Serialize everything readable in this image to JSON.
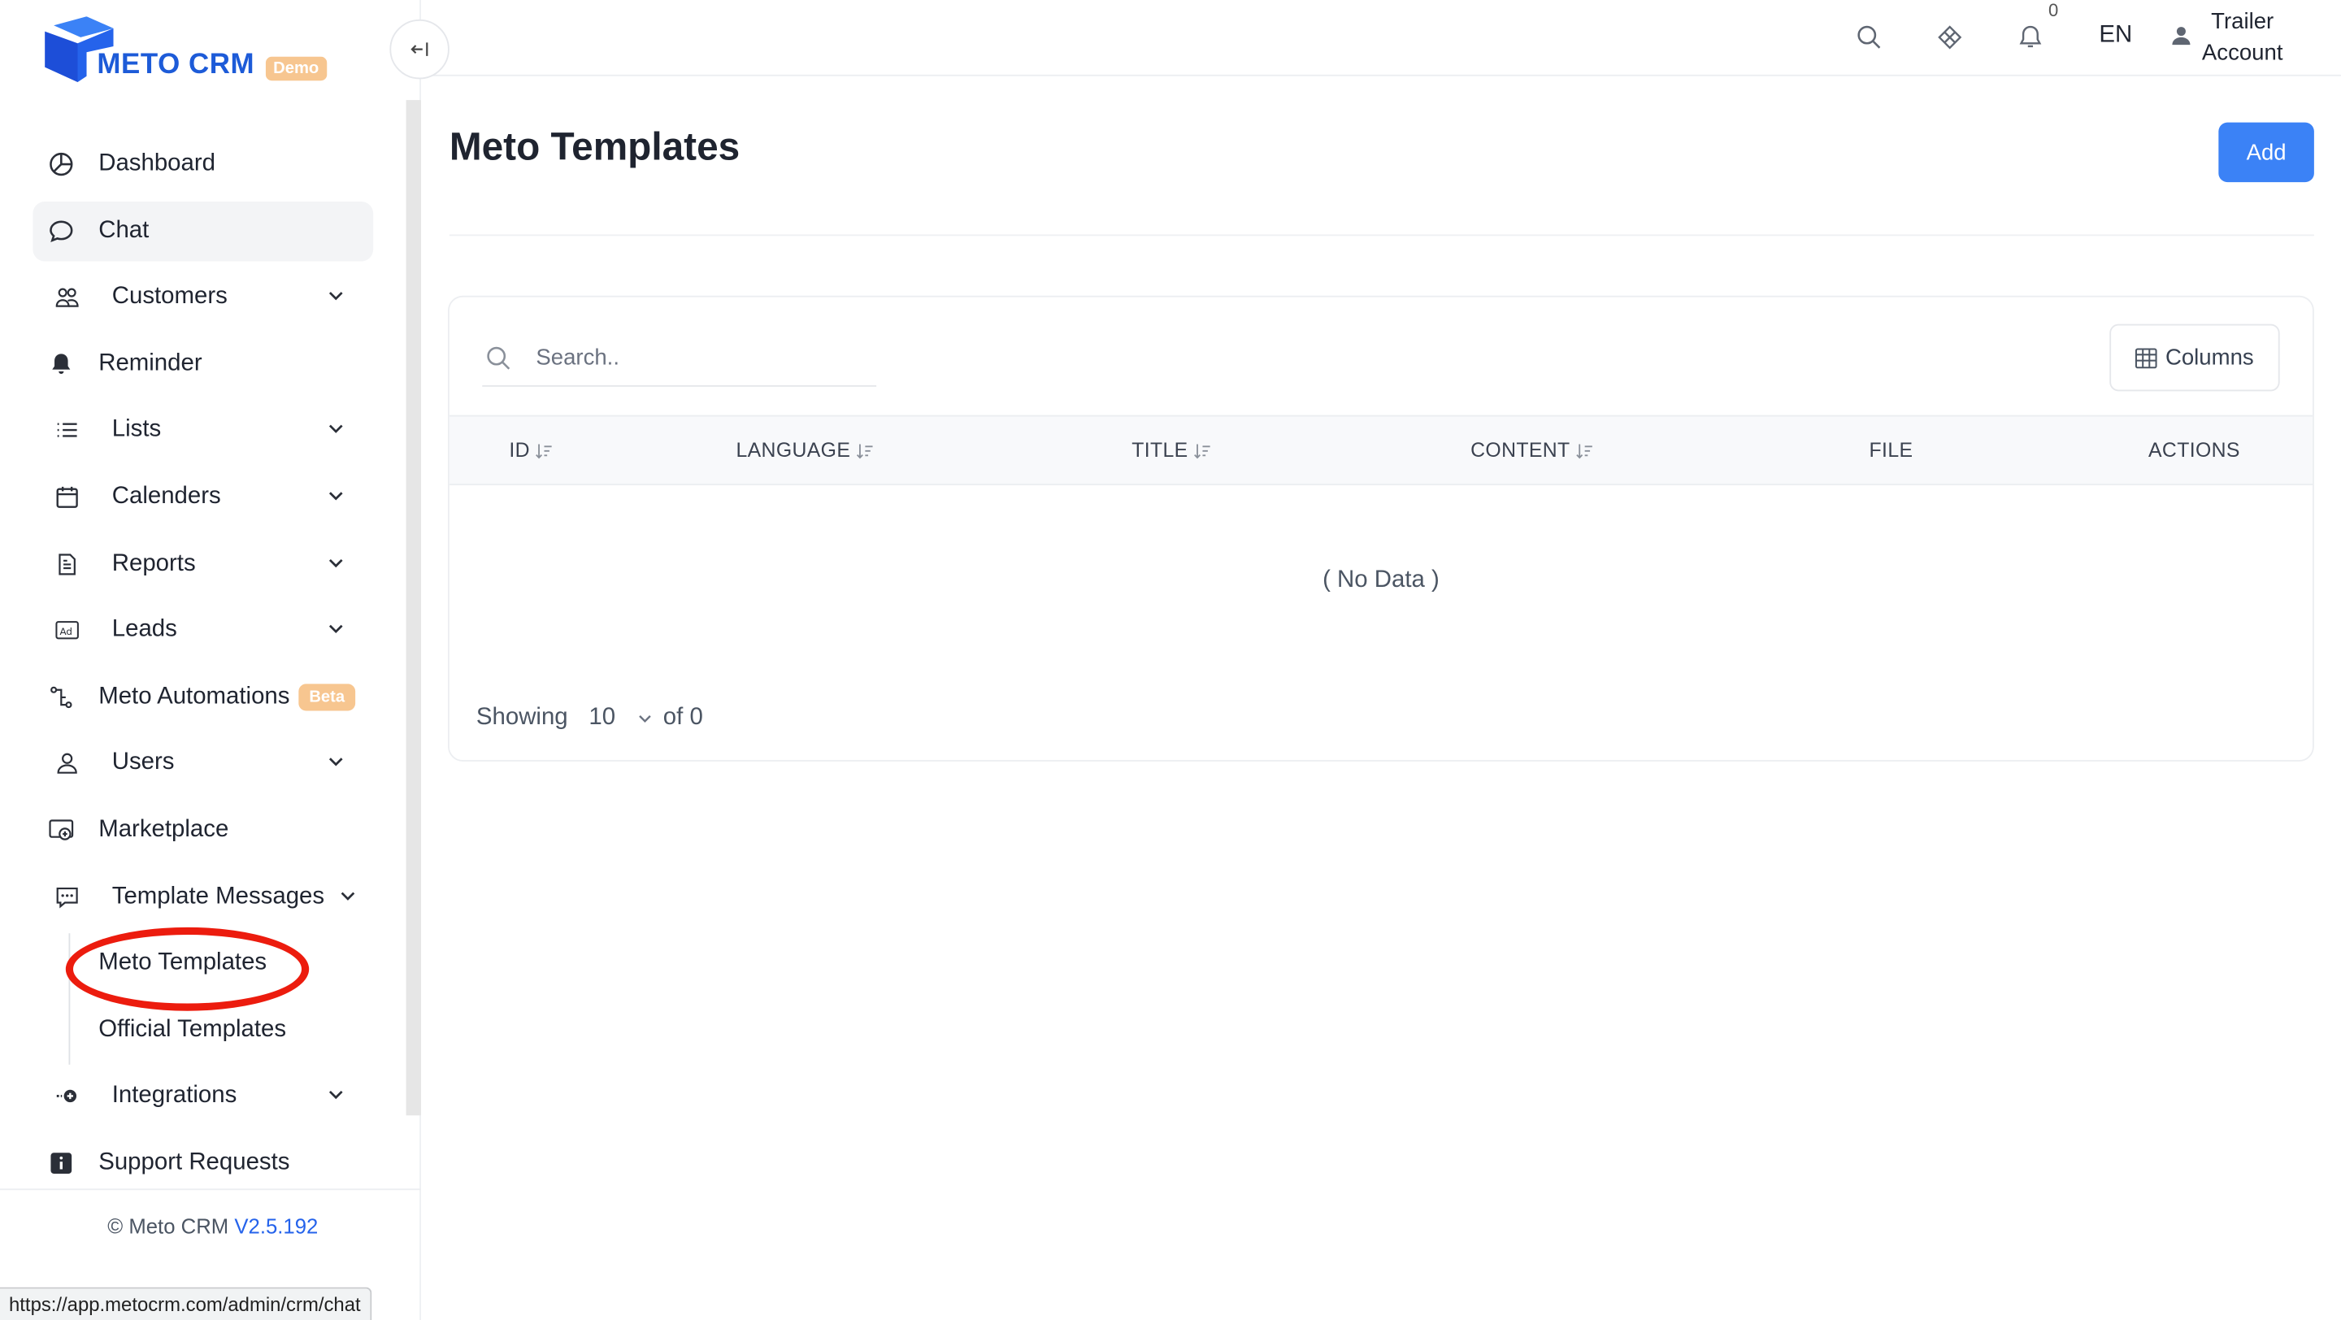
{
  "brand": {
    "name": "METO CRM",
    "badge": "Demo"
  },
  "sidebar": {
    "items": [
      {
        "label": "Dashboard"
      },
      {
        "label": "Chat"
      },
      {
        "label": "Customers"
      },
      {
        "label": "Reminder"
      },
      {
        "label": "Lists"
      },
      {
        "label": "Calenders"
      },
      {
        "label": "Reports"
      },
      {
        "label": "Leads"
      },
      {
        "label": "Meto Automations",
        "badge": "Beta"
      },
      {
        "label": "Users"
      },
      {
        "label": "Marketplace"
      },
      {
        "label": "Template Messages"
      },
      {
        "label": "Integrations"
      },
      {
        "label": "Support Requests"
      }
    ],
    "sub_items": [
      {
        "label": "Meto Templates"
      },
      {
        "label": "Official Templates"
      }
    ],
    "footer": {
      "copyright": "© Meto CRM",
      "version": "V2.5.192"
    }
  },
  "status_url": "https://app.metocrm.com/admin/crm/chat",
  "header": {
    "notification_count": "0",
    "language": "EN",
    "user_first": "Trailer",
    "user_last": "Account"
  },
  "main": {
    "title": "Meto Templates",
    "add_label": "Add",
    "search_placeholder": "Search..",
    "columns_label": "Columns",
    "table": {
      "headers": [
        "ID",
        "LANGUAGE",
        "TITLE",
        "CONTENT",
        "FILE",
        "ACTIONS"
      ],
      "rows": [],
      "empty_text": "( No Data )"
    },
    "pagination": {
      "showing_label": "Showing",
      "page_size": "10",
      "of_label": "of 0"
    }
  },
  "colors": {
    "accent": "#3b82f6",
    "brand": "#1d5bd8",
    "badge": "#f7c690",
    "annotation": "#ec1c0e"
  }
}
